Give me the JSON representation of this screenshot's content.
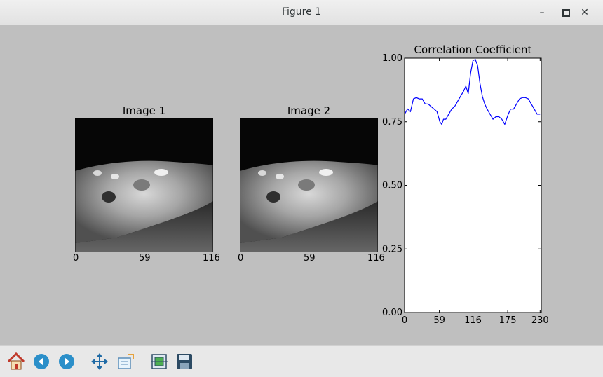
{
  "window": {
    "title": "Figure 1"
  },
  "titlebar_controls": {
    "minimize": "minimize-icon",
    "maximize": "maximize-icon",
    "close": "close-icon"
  },
  "figure": {
    "image1": {
      "title": "Image 1",
      "xticks": [
        "0",
        "59",
        "116"
      ]
    },
    "image2": {
      "title": "Image 2",
      "xticks": [
        "0",
        "59",
        "116"
      ]
    }
  },
  "chart_data": {
    "type": "line",
    "title": "Correlation Coefficient",
    "xlabel": "",
    "ylabel": "",
    "xlim": [
      0,
      232
    ],
    "ylim": [
      0.0,
      1.0
    ],
    "xticks": [
      "0",
      "59",
      "116",
      "175",
      "230"
    ],
    "yticks": [
      "0.00",
      "0.25",
      "0.50",
      "0.75",
      "1.00"
    ],
    "grid": false,
    "series": [
      {
        "color": "#0000ff",
        "x": [
          0,
          5,
          10,
          15,
          20,
          25,
          30,
          35,
          40,
          45,
          50,
          55,
          60,
          63,
          66,
          70,
          75,
          80,
          85,
          90,
          95,
          100,
          104,
          108,
          112,
          116,
          120,
          124,
          128,
          132,
          136,
          140,
          145,
          150,
          155,
          160,
          165,
          170,
          173,
          176,
          180,
          185,
          190,
          195,
          200,
          205,
          210,
          215,
          220,
          225,
          230
        ],
        "y": [
          0.78,
          0.8,
          0.79,
          0.84,
          0.845,
          0.84,
          0.84,
          0.82,
          0.82,
          0.81,
          0.8,
          0.79,
          0.75,
          0.74,
          0.76,
          0.76,
          0.78,
          0.8,
          0.81,
          0.83,
          0.85,
          0.87,
          0.89,
          0.86,
          0.94,
          0.99,
          0.995,
          0.97,
          0.9,
          0.85,
          0.82,
          0.8,
          0.78,
          0.76,
          0.77,
          0.77,
          0.76,
          0.74,
          0.76,
          0.78,
          0.8,
          0.8,
          0.82,
          0.84,
          0.845,
          0.845,
          0.84,
          0.82,
          0.8,
          0.78,
          0.78
        ]
      }
    ]
  },
  "toolbar": {
    "home": "home-icon",
    "back": "back-arrow-icon",
    "forward": "forward-arrow-icon",
    "pan": "pan-icon",
    "zoom": "zoom-icon",
    "subplots": "subplots-icon",
    "save": "save-icon"
  }
}
